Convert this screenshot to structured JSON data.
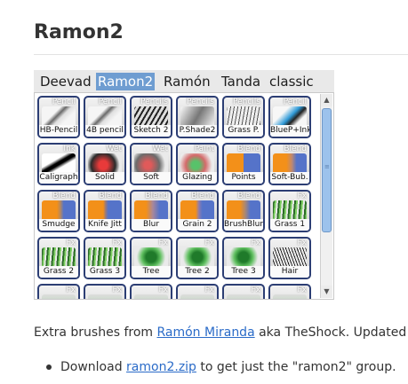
{
  "page": {
    "title": "Ramon2"
  },
  "tabs": [
    {
      "label": "Deevad",
      "active": false
    },
    {
      "label": "Ramon2",
      "active": true
    },
    {
      "label": "Ramón",
      "active": false
    },
    {
      "label": "Tanda",
      "active": false
    },
    {
      "label": "classic",
      "active": false
    }
  ],
  "brushes": [
    {
      "tag": "Pencil",
      "label": "HB-Pencil",
      "icon": "pencil-stroke-icon"
    },
    {
      "tag": "Pencil",
      "label": "4B pencil",
      "icon": "pencil-stroke-icon"
    },
    {
      "tag": "Pencils",
      "label": "Sketch 2",
      "icon": "sketch-stroke-icon"
    },
    {
      "tag": "Pencils",
      "label": "P.Shade2",
      "icon": "shade-stroke-icon"
    },
    {
      "tag": "Pencils",
      "label": "Grass P.",
      "icon": "grass-pencil-icon"
    },
    {
      "tag": "Pencil",
      "label": "BlueP+Ink",
      "icon": "blue-pencil-ink-icon"
    },
    {
      "tag": "Ink",
      "label": "Caligraph",
      "icon": "calligraphy-stroke-icon"
    },
    {
      "tag": "Wet",
      "label": "Solid",
      "icon": "wet-solid-icon"
    },
    {
      "tag": "Wet",
      "label": "Soft",
      "icon": "wet-soft-icon"
    },
    {
      "tag": "Paint",
      "label": "Glazing",
      "icon": "glazing-paint-icon"
    },
    {
      "tag": "Blend",
      "label": "Points",
      "icon": "blend-points-icon"
    },
    {
      "tag": "Blend",
      "label": "Soft-Bub.",
      "icon": "blend-soft-icon"
    },
    {
      "tag": "Blend",
      "label": "Smudge",
      "icon": "blend-smudge-icon"
    },
    {
      "tag": "Blend",
      "label": "Knife Jitt",
      "icon": "blend-knife-icon"
    },
    {
      "tag": "Blend",
      "label": "Blur",
      "icon": "blend-blur-icon"
    },
    {
      "tag": "Blend",
      "label": "Grain 2",
      "icon": "blend-grain-icon"
    },
    {
      "tag": "Blend",
      "label": "BrushBlur",
      "icon": "blend-brushblur-icon"
    },
    {
      "tag": "Fx",
      "label": "Grass 1",
      "icon": "fx-grass-icon"
    },
    {
      "tag": "Fx",
      "label": "Grass 2",
      "icon": "fx-grass-icon"
    },
    {
      "tag": "Fx",
      "label": "Grass 3",
      "icon": "fx-grass-icon"
    },
    {
      "tag": "Fx",
      "label": "Tree",
      "icon": "fx-tree-icon"
    },
    {
      "tag": "Fx",
      "label": "Tree 2",
      "icon": "fx-tree-icon"
    },
    {
      "tag": "Fx",
      "label": "Tree 3",
      "icon": "fx-tree-icon"
    },
    {
      "tag": "Fx",
      "label": "Hair",
      "icon": "fx-hair-icon"
    },
    {
      "tag": "Fx",
      "label": "",
      "icon": "fx-partial-icon"
    },
    {
      "tag": "Fx",
      "label": "",
      "icon": "fx-partial-icon"
    },
    {
      "tag": "Fx",
      "label": "",
      "icon": "fx-partial-icon"
    },
    {
      "tag": "Fx",
      "label": "",
      "icon": "fx-partial-icon"
    },
    {
      "tag": "Fx",
      "label": "",
      "icon": "fx-partial-icon"
    },
    {
      "tag": "Fx",
      "label": "",
      "icon": "fx-partial-icon"
    }
  ],
  "scrollbar": {
    "up_icon": "scroll-up-arrow-icon",
    "down_icon": "scroll-down-arrow-icon"
  },
  "description": {
    "prefix": "Extra brushes from ",
    "link_text": "Ramón Miranda",
    "suffix": " aka TheShock. Updated"
  },
  "download": {
    "prefix": "Download ",
    "link_text": "ramon2.zip",
    "suffix": " to get just the \"ramon2\" group."
  },
  "colors": {
    "active_tab": "#6f9dd1",
    "link": "#2a6bc8",
    "cell_border": "#2c3e74",
    "scroll_thumb": "#9cc2ec"
  }
}
